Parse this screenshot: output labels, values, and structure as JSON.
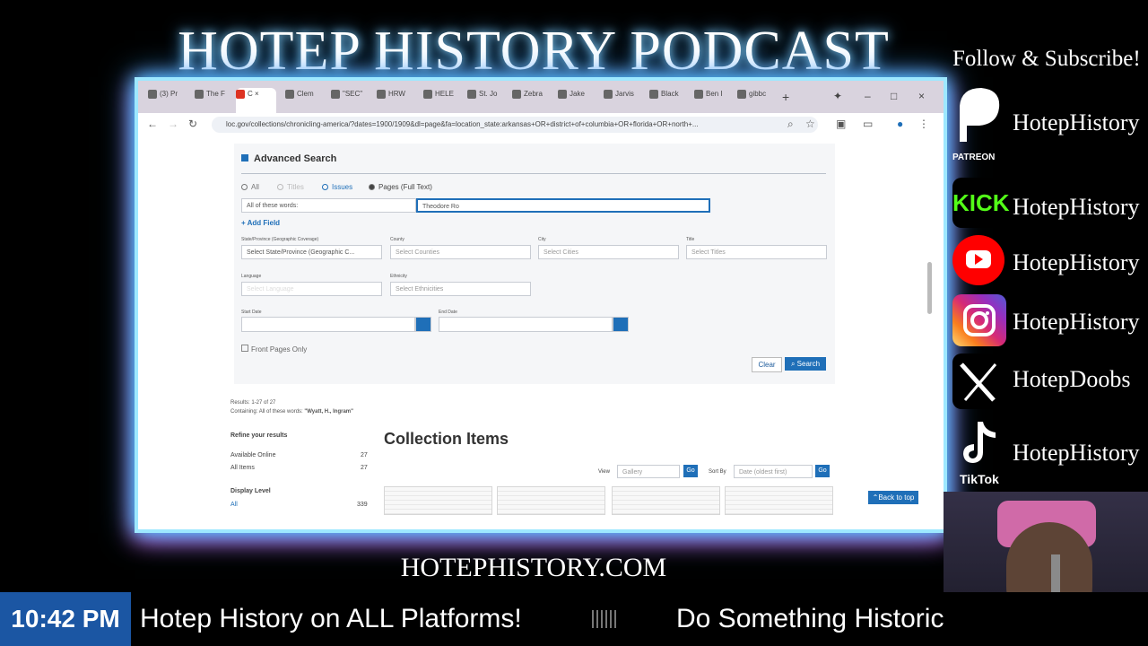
{
  "stream": {
    "title": "HOTEP HISTORY PODCAST",
    "website": "HOTEPHISTORY.COM",
    "follow_text": "Follow & Subscribe!",
    "time": "10:42 PM",
    "ticker_1": "Hotep History on ALL Platforms!",
    "ticker_2": "Do Something Historic"
  },
  "socials": [
    {
      "platform": "Patreon",
      "label": "PATREON",
      "handle": "HotepHistory",
      "icon": "patreon-icon",
      "color": "#f96854"
    },
    {
      "platform": "Kick",
      "label": "KICK",
      "handle": "HotepHistory",
      "icon": "kick-icon",
      "color": "#53fc18"
    },
    {
      "platform": "YouTube",
      "handle": "HotepHistory",
      "icon": "youtube-icon",
      "color": "#ff0000"
    },
    {
      "platform": "Instagram",
      "handle": "HotepHistory",
      "icon": "instagram-icon",
      "color": "#d6249f"
    },
    {
      "platform": "X",
      "handle": "HotepDoobs",
      "icon": "x-icon",
      "color": "#000000"
    },
    {
      "platform": "TikTok",
      "label": "TikTok",
      "handle": "HotepHistory",
      "icon": "tiktok-icon",
      "color": "#000000"
    }
  ],
  "browser": {
    "url": "loc.gov/collections/chronicling-america/?dates=1900/1909&dl=page&fa=location_state:arkansas+OR+district+of+columbia+OR+florida+OR+north+...",
    "tabs": [
      {
        "label": "(3) Pr",
        "icon": "x-icon"
      },
      {
        "label": "The F",
        "icon": "page-icon"
      },
      {
        "label": "C",
        "icon": "library-icon"
      },
      {
        "label": "Clem",
        "icon": "wikipedia-icon"
      },
      {
        "label": "\"SEC\"",
        "icon": "page-icon"
      },
      {
        "label": "HRW",
        "icon": "globe-icon"
      },
      {
        "label": "HELE",
        "icon": "page-icon"
      },
      {
        "label": "St. Jo",
        "icon": "google-icon"
      },
      {
        "label": "Zebra",
        "icon": "wikipedia-icon"
      },
      {
        "label": "Jake",
        "icon": "google-icon"
      },
      {
        "label": "Jarvis",
        "icon": "wikipedia-icon"
      },
      {
        "label": "Black",
        "icon": "page-icon"
      },
      {
        "label": "Ben I",
        "icon": "page-icon"
      },
      {
        "label": "gibbc",
        "icon": "google-icon"
      }
    ]
  },
  "advanced_search": {
    "title": "Advanced Search",
    "type_options": [
      "All",
      "Titles",
      "Issues",
      "Pages (Full Text)"
    ],
    "selected_type": "Pages (Full Text)",
    "words_mode": "All of these words:",
    "query": "Theodore Ro",
    "add_field": "Add Field",
    "labels": {
      "state": "State/Province (Geographic Coverage)",
      "county": "County",
      "city": "City",
      "title": "Title",
      "language": "Language",
      "ethnicity": "Ethnicity",
      "start_date": "Start Date",
      "end_date": "End Date"
    },
    "placeholders": {
      "state": "Select State/Province (Geographic C...",
      "county": "Select Counties",
      "city": "Select Cities",
      "title": "Select Titles",
      "language": "Select Language",
      "ethnicity": "Select Ethnicities"
    },
    "front_pages_only": "Front Pages Only",
    "clear": "Clear",
    "search": "Search"
  },
  "results": {
    "count": "Results: 1-27 of 27",
    "containing_label": "Containing: All of these words:",
    "containing_value": "\"Wyatt, H., Ingram\"",
    "heading": "Collection Items",
    "refine_title": "Refine your results",
    "available_online": "Available Online",
    "available_online_count": "27",
    "all_items": "All Items",
    "all_items_count": "27",
    "display_level": "Display Level",
    "display_all": "All",
    "display_all_count": "339",
    "view_label": "View",
    "view_value": "Gallery",
    "sort_label": "Sort By",
    "sort_value": "Date (oldest first)",
    "go": "Go",
    "back_to_top": "Back to top"
  }
}
